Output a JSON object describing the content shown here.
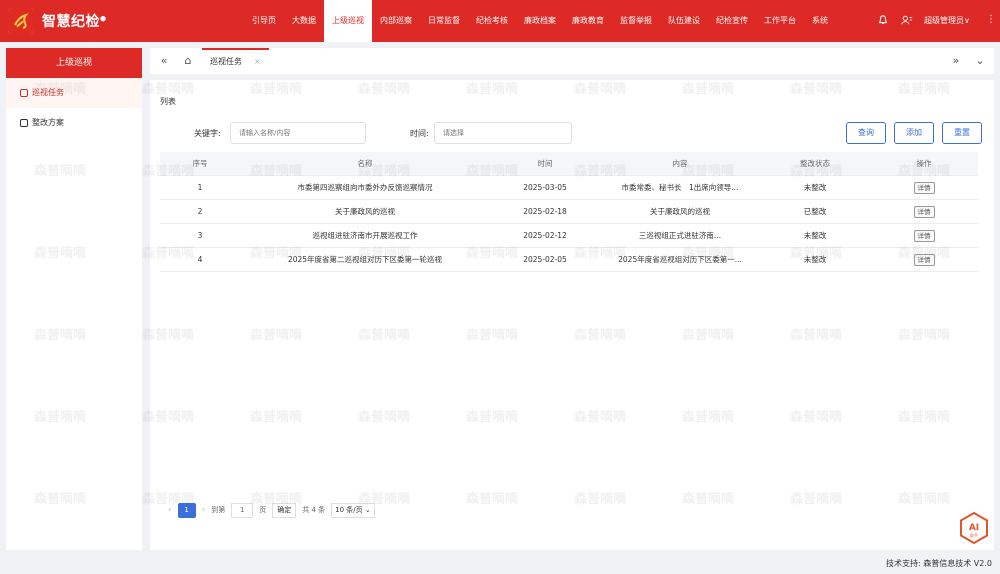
{
  "header": {
    "brand": "智慧纪检",
    "brand_suffix": "●",
    "nav": [
      "引导页",
      "大数据",
      "上级巡视",
      "内部巡察",
      "日常监督",
      "纪检考核",
      "廉政档案",
      "廉政教育",
      "监督举报",
      "队伍建设",
      "纪检宣传",
      "工作平台",
      "系统"
    ],
    "active_nav_index": 2,
    "admin": "超级管理员∨",
    "more": "⋮"
  },
  "sidebar": {
    "title": "上级巡视",
    "items": [
      {
        "label": "巡视任务",
        "active": true
      },
      {
        "label": "整改方案",
        "active": false
      }
    ]
  },
  "tabbar": {
    "collapse": "«",
    "home": "⌂",
    "tab_label": "巡视任务",
    "tab_close": "×",
    "expand": "»",
    "dropdown": "⌄"
  },
  "content": {
    "section_title": "列表",
    "keyword_label": "关键字:",
    "keyword_placeholder": "请输入名称/内容",
    "time_label": "时间:",
    "time_placeholder": "请选择",
    "buttons": {
      "search": "查询",
      "add": "添加",
      "reset": "重置"
    }
  },
  "table": {
    "headers": [
      "序号",
      "名称",
      "时间",
      "内容",
      "整改状态",
      "操作"
    ],
    "rows": [
      {
        "no": "1",
        "name": "市委第四巡察组向市委外办反馈巡察情况",
        "time": "2025-03-05",
        "content": "市委常委、秘书长　1出席向领导...",
        "status": "未整改",
        "action": "详情"
      },
      {
        "no": "2",
        "name": "关于廉政风的巡视",
        "time": "2025-02-18",
        "content": "关于廉政风的巡视",
        "status": "已整改",
        "action": "详情"
      },
      {
        "no": "3",
        "name": "巡视组进驻济南市开展巡视工作",
        "time": "2025-02-12",
        "content": "三巡视组正式进驻济南...",
        "status": "未整改",
        "action": "详情"
      },
      {
        "no": "4",
        "name": "2025年度省第二巡视组对历下区委第一轮巡视",
        "time": "2025-02-05",
        "content": "2025年度省巡视组对历下区委第一...",
        "status": "未整改",
        "action": "详情"
      }
    ]
  },
  "pager": {
    "prev": "‹",
    "current": "1",
    "next": "›",
    "goto_label": "到第",
    "goto_value": "1",
    "page_unit": "页",
    "confirm": "确定",
    "total": "共 4 条",
    "page_size": "10 条/页 ⌄"
  },
  "ai_badge": {
    "label": "AI",
    "sub": "助手"
  },
  "footer": "技术支持: 森普信息技术  V2.0",
  "watermark_text": "森普嘀嘀",
  "colors": {
    "brand_red": "#dd2a26",
    "accent_blue": "#3a6fd9"
  }
}
